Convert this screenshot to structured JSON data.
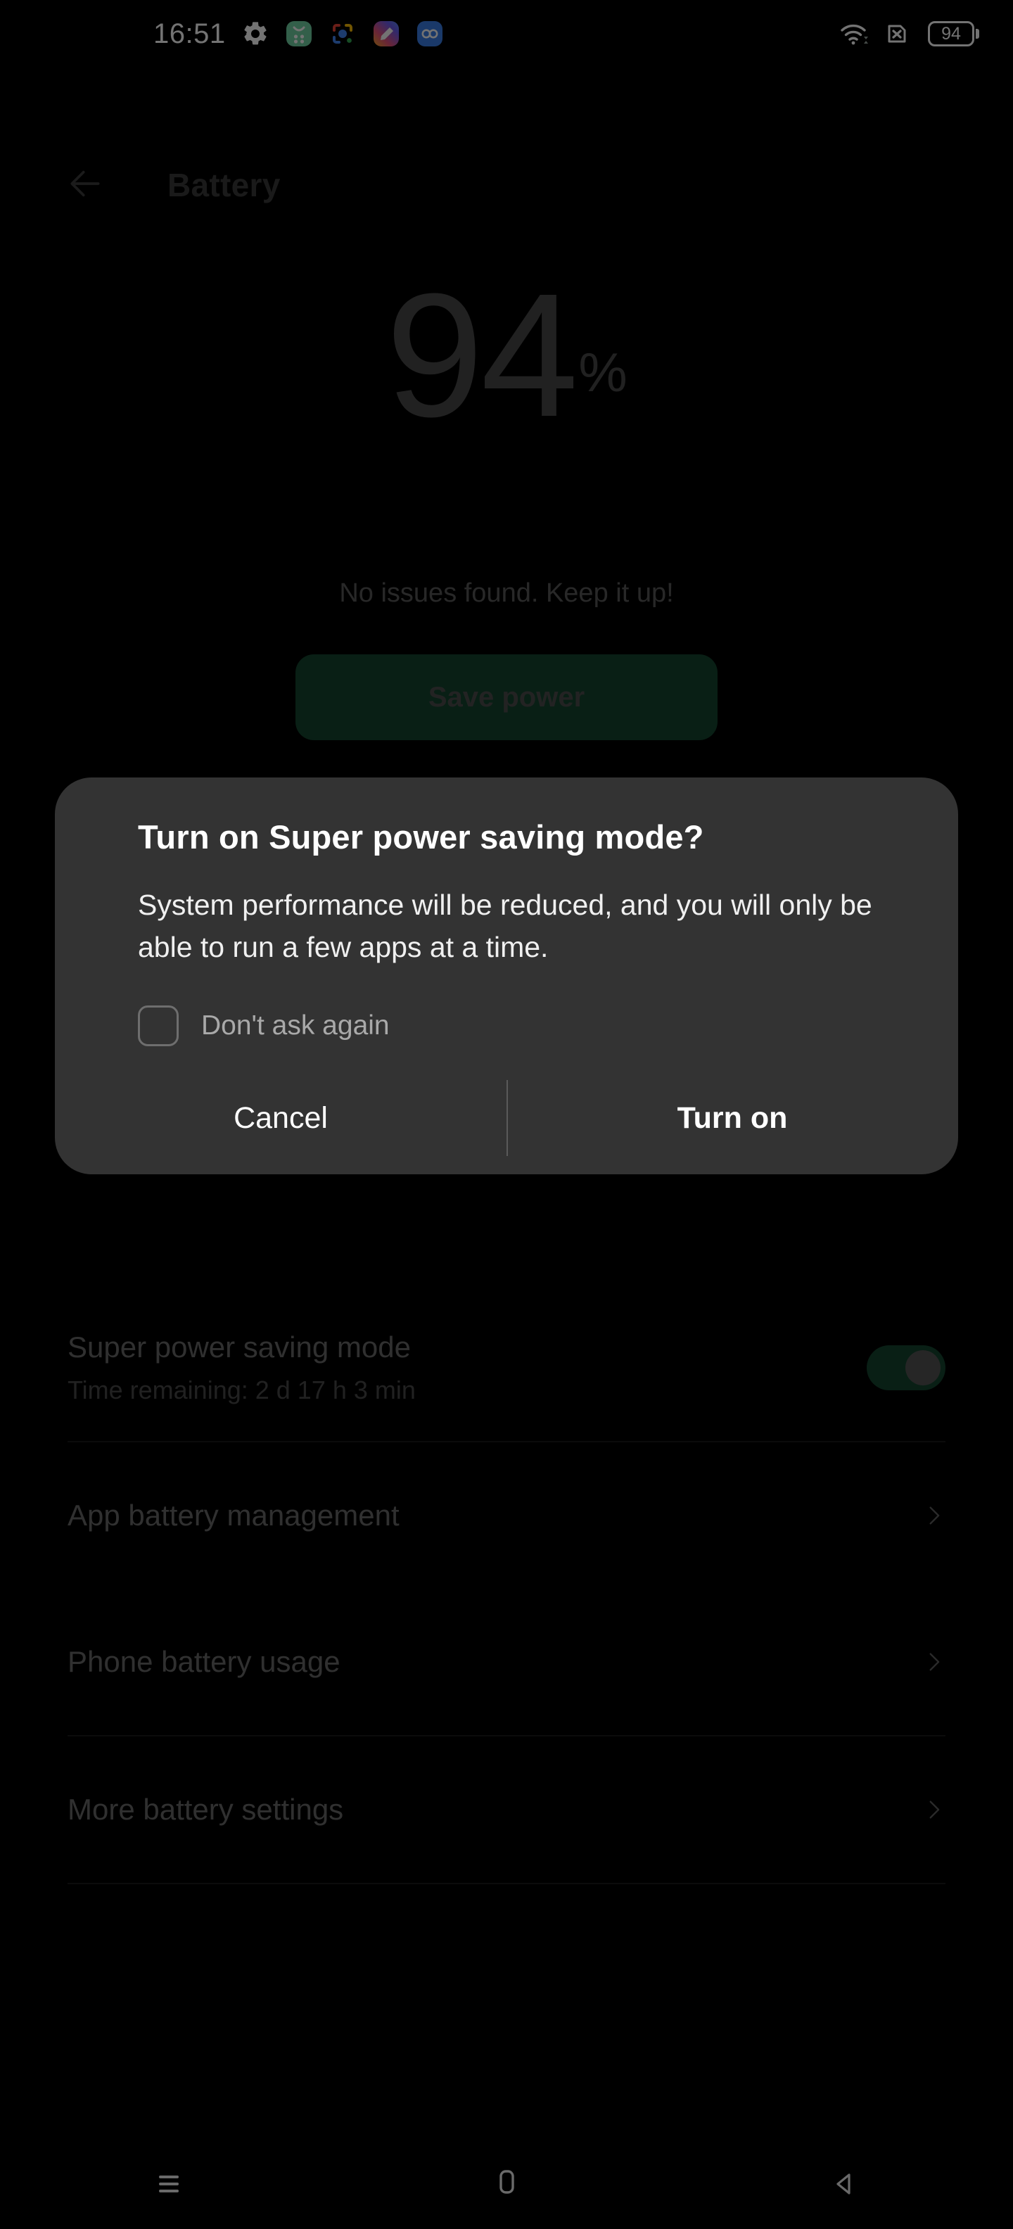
{
  "status_bar": {
    "clock": "16:51",
    "left_icons": [
      {
        "name": "settings-gear-icon",
        "label": "Settings"
      },
      {
        "name": "green-app-icon",
        "label": "App"
      },
      {
        "name": "google-lens-icon",
        "label": "Lens"
      },
      {
        "name": "gradient-app-icon",
        "label": "App"
      },
      {
        "name": "infinity-app-icon",
        "label": "App"
      }
    ],
    "right_icons": [
      {
        "name": "wifi-icon",
        "label": "Wi-Fi"
      },
      {
        "name": "no-sim-icon",
        "label": "No SIM"
      }
    ],
    "battery_level": "94"
  },
  "app_bar": {
    "back_label": "Back",
    "title": "Battery"
  },
  "hero": {
    "percent": "94",
    "percent_sign": "%",
    "subtitle": "No issues found. Keep it up!",
    "save_power_label": "Save power",
    "save_power_color": "#14452f"
  },
  "list": {
    "rows": [
      {
        "title": "Super power saving mode",
        "subtitle": "Time remaining:  2 d 17 h 3 min",
        "control": "toggle",
        "toggle_on": true
      },
      {
        "title": "App battery management",
        "subtitle": "",
        "control": "chevron"
      },
      {
        "title": "Phone battery usage",
        "subtitle": "",
        "control": "chevron"
      },
      {
        "title": "More battery settings",
        "subtitle": "",
        "control": "chevron"
      }
    ]
  },
  "dialog": {
    "title": "Turn on Super power saving mode?",
    "body": "System performance will be reduced, and you will only be able to run a few apps at a time.",
    "checkbox_label": "Don't ask again",
    "checkbox_checked": false,
    "cancel_label": "Cancel",
    "confirm_label": "Turn on",
    "background_color": "#333333"
  },
  "nav_bar": {
    "recent_label": "Recent apps",
    "home_label": "Home",
    "back_label": "Back"
  }
}
